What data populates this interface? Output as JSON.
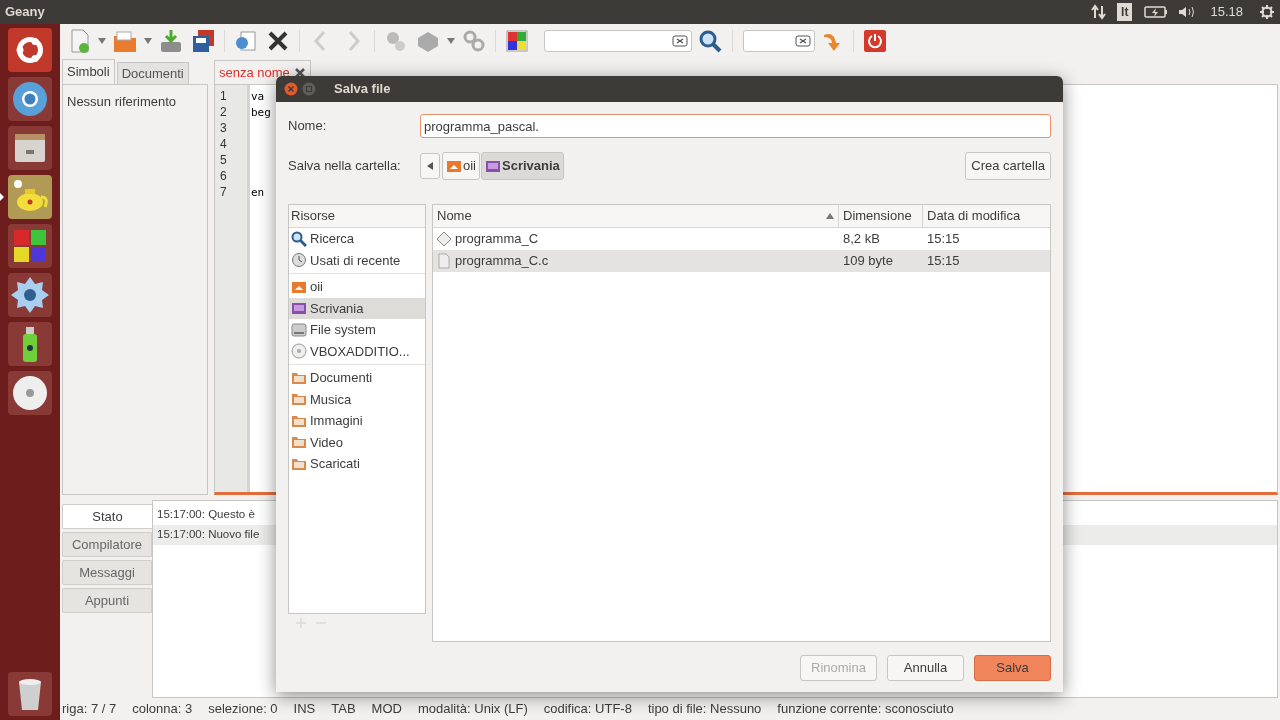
{
  "top_panel": {
    "app_name": "Geany",
    "keyboard_layout": "It",
    "clock": "15.18"
  },
  "launcher": [
    {
      "kind": "ubuntu",
      "active": false
    },
    {
      "kind": "browser",
      "active": false
    },
    {
      "kind": "cabinet",
      "active": false
    },
    {
      "kind": "teapot",
      "active": true
    },
    {
      "kind": "squares",
      "active": false
    },
    {
      "kind": "gear",
      "active": false
    },
    {
      "kind": "spray",
      "active": false
    },
    {
      "kind": "disc",
      "active": false
    },
    {
      "kind": "trash",
      "active": false
    }
  ],
  "sidebar": {
    "tabs": [
      {
        "label": "Simboli",
        "selected": true
      },
      {
        "label": "Documenti",
        "selected": false
      }
    ],
    "empty_text": "Nessun riferimento"
  },
  "editor": {
    "tab": {
      "label": "senza nome",
      "modified": true
    },
    "lines": [
      {
        "number": "1",
        "code": "va"
      },
      {
        "number": "2",
        "code": "beg"
      },
      {
        "number": "3"
      },
      {
        "number": "4"
      },
      {
        "number": "5"
      },
      {
        "number": "6"
      },
      {
        "number": "7",
        "code": "en"
      }
    ]
  },
  "message_tabs": [
    {
      "label": "Stato",
      "selected": true
    },
    {
      "label": "Compilatore",
      "selected": false
    },
    {
      "label": "Messaggi",
      "selected": false
    },
    {
      "label": "Appunti",
      "selected": false
    }
  ],
  "log": [
    "15:17:00: Questo è",
    "15:17:00: Nuovo file"
  ],
  "status_bar": [
    "riga: 7 / 7",
    "colonna: 3",
    "selezione: 0",
    "INS",
    "TAB",
    "MOD",
    "modalità: Unix (LF)",
    "codifica: UTF-8",
    "tipo di file: Nessuno",
    "funzione corrente: sconosciuto"
  ],
  "dialog": {
    "title": "Salva file",
    "name_label": "Nome:",
    "name_value": "programma_pascal.",
    "folder_label": "Salva nella cartella:",
    "path": [
      {
        "label": "oii",
        "kind": "home",
        "selected": false
      },
      {
        "label": "Scrivania",
        "kind": "desktop",
        "selected": true
      }
    ],
    "create_folder": "Crea cartella",
    "places_header": "Risorse",
    "places": [
      [
        {
          "label": "Ricerca",
          "kind": "search",
          "selected": false
        },
        {
          "label": "Usati di recente",
          "kind": "recent",
          "selected": false
        }
      ],
      [
        {
          "label": "oii",
          "kind": "home",
          "selected": false
        },
        {
          "label": "Scrivania",
          "kind": "desktop",
          "selected": true
        },
        {
          "label": "File system",
          "kind": "drive",
          "selected": false
        },
        {
          "label": "VBOXADDITIO...",
          "kind": "disc",
          "selected": false
        }
      ],
      [
        {
          "label": "Documenti",
          "kind": "folder",
          "selected": false
        },
        {
          "label": "Musica",
          "kind": "folder",
          "selected": false
        },
        {
          "label": "Immagini",
          "kind": "folder",
          "selected": false
        },
        {
          "label": "Video",
          "kind": "folder",
          "selected": false
        },
        {
          "label": "Scaricati",
          "kind": "folder",
          "selected": false
        }
      ]
    ],
    "columns": [
      "Nome",
      "Dimensione",
      "Data di modifica"
    ],
    "files": [
      {
        "name": "programma_C",
        "kind": "executable",
        "size": "8,2 kB",
        "modified": "15:15",
        "selected": false
      },
      {
        "name": "programma_C.c",
        "kind": "text",
        "size": "109 byte",
        "modified": "15:15",
        "selected": true
      }
    ],
    "buttons": [
      {
        "label": "Rinomina",
        "kind": "normal",
        "disabled": true
      },
      {
        "label": "Annulla",
        "kind": "normal",
        "disabled": false
      },
      {
        "label": "Salva",
        "kind": "default",
        "disabled": false
      }
    ]
  }
}
